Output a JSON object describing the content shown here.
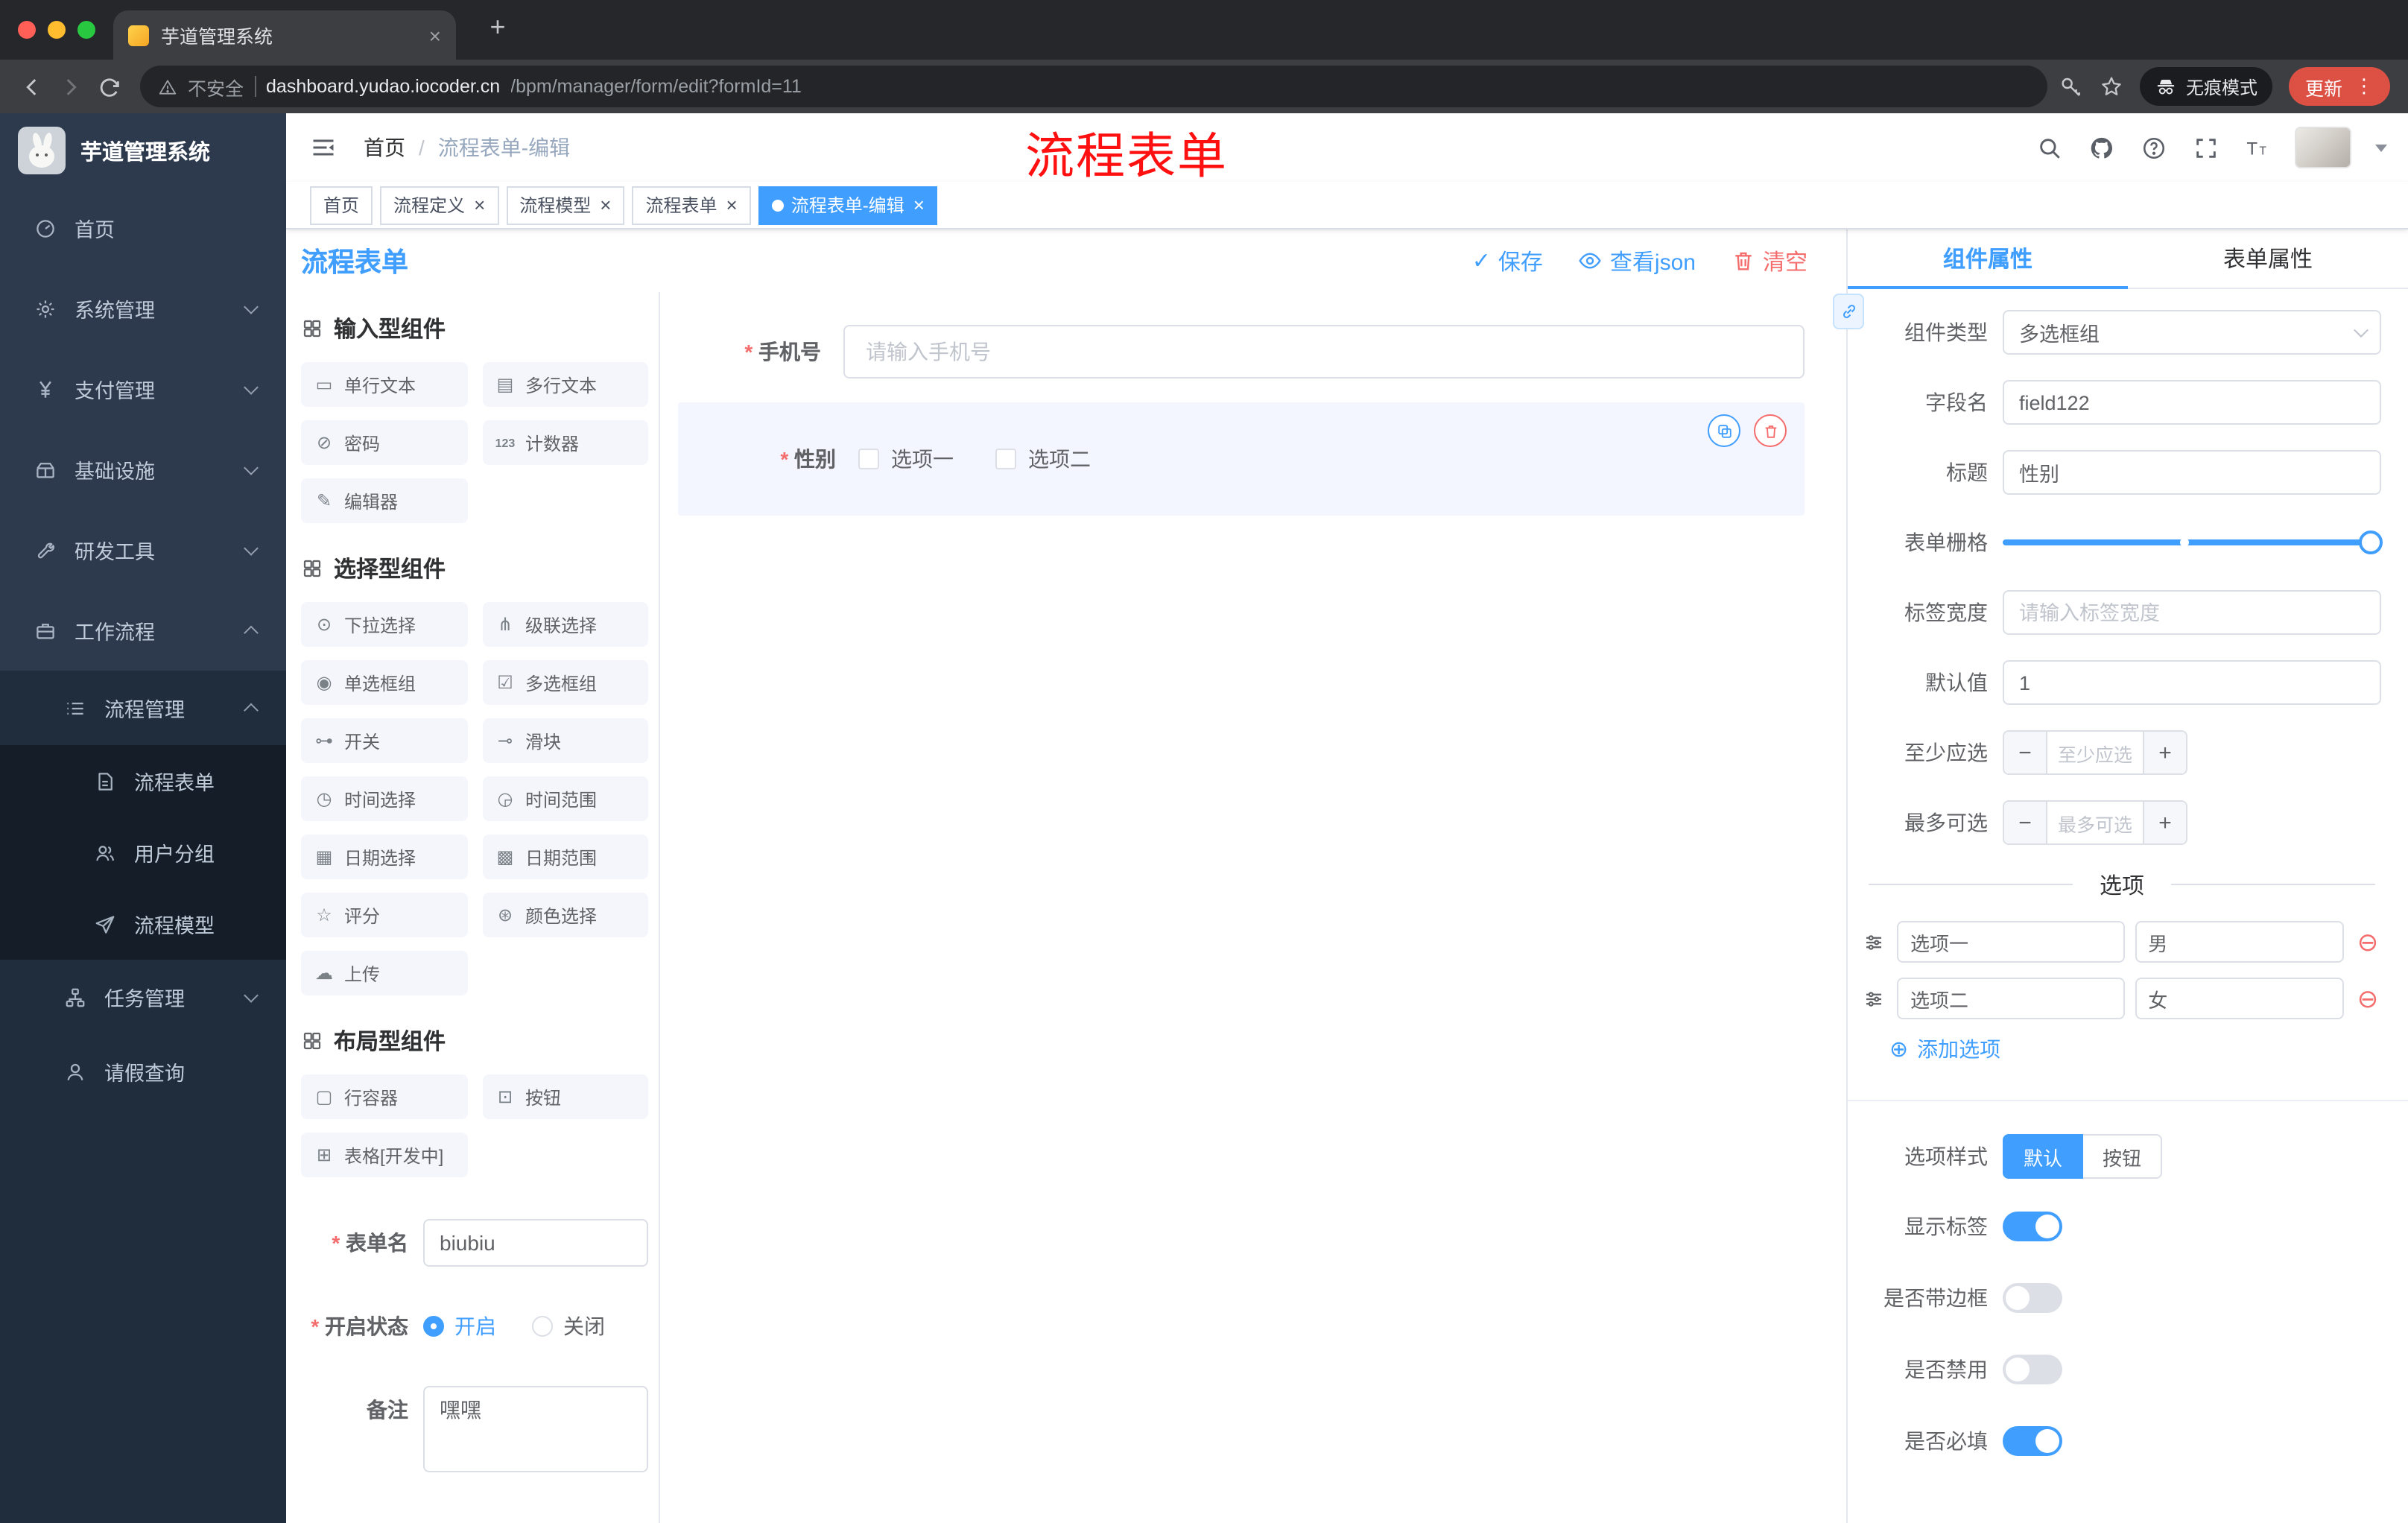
{
  "colors": {
    "accent": "#409eff",
    "danger": "#f56c6c",
    "annotation_red": "#fe1010",
    "update_badge": "#dd5144",
    "sidebar_bg": "#2d3a4d"
  },
  "browser": {
    "tab": {
      "title": "芋道管理系统"
    },
    "address": {
      "security": "不安全",
      "host": "dashboard.yudao.iocoder.cn",
      "path": "/bpm/manager/form/edit?formId=11"
    },
    "incognito_label": "无痕模式",
    "update_label": "更新"
  },
  "sidebar": {
    "logo_title": "芋道管理系统",
    "menu": [
      {
        "label": "首页",
        "icon": "dashboard-icon",
        "level": 1
      },
      {
        "label": "系统管理",
        "icon": "gear-icon",
        "level": 1,
        "chevron": "down"
      },
      {
        "label": "支付管理",
        "icon": "yen-icon",
        "level": 1,
        "chevron": "down"
      },
      {
        "label": "基础设施",
        "icon": "infra-icon",
        "level": 1,
        "chevron": "down"
      },
      {
        "label": "研发工具",
        "icon": "tools-icon",
        "level": 1,
        "chevron": "down"
      },
      {
        "label": "工作流程",
        "icon": "workflow-icon",
        "level": 1,
        "chevron": "up"
      },
      {
        "label": "流程管理",
        "icon": "list-icon",
        "level": 2,
        "chevron": "up"
      },
      {
        "label": "流程表单",
        "icon": "form-icon",
        "level": 3
      },
      {
        "label": "用户分组",
        "icon": "users-icon",
        "level": 3
      },
      {
        "label": "流程模型",
        "icon": "send-icon",
        "level": 3
      },
      {
        "label": "任务管理",
        "icon": "tasks-icon",
        "level": 2,
        "chevron": "down"
      },
      {
        "label": "请假查询",
        "icon": "person-icon",
        "level": 2
      }
    ]
  },
  "header": {
    "breadcrumb": [
      "首页",
      "流程表单-编辑"
    ],
    "annotation": "流程表单"
  },
  "tags": [
    {
      "label": "首页",
      "closable": false,
      "active": false
    },
    {
      "label": "流程定义",
      "closable": true,
      "active": false
    },
    {
      "label": "流程模型",
      "closable": true,
      "active": false
    },
    {
      "label": "流程表单",
      "closable": true,
      "active": false
    },
    {
      "label": "流程表单-编辑",
      "closable": true,
      "active": true
    }
  ],
  "designer": {
    "title": "流程表单",
    "actions": {
      "save": "保存",
      "view_json": "查看json",
      "clear": "清空"
    },
    "palette": {
      "sections": [
        {
          "title": "输入型组件",
          "items": [
            {
              "label": "单行文本",
              "icon": "input-icon"
            },
            {
              "label": "多行文本",
              "icon": "textarea-icon"
            },
            {
              "label": "密码",
              "icon": "password-icon"
            },
            {
              "label": "计数器",
              "icon": "counter-icon"
            },
            {
              "label": "编辑器",
              "icon": "editor-icon"
            }
          ]
        },
        {
          "title": "选择型组件",
          "items": [
            {
              "label": "下拉选择",
              "icon": "select-icon"
            },
            {
              "label": "级联选择",
              "icon": "cascader-icon"
            },
            {
              "label": "单选框组",
              "icon": "radio-icon"
            },
            {
              "label": "多选框组",
              "icon": "checkbox-icon"
            },
            {
              "label": "开关",
              "icon": "switch-icon"
            },
            {
              "label": "滑块",
              "icon": "slider-icon"
            },
            {
              "label": "时间选择",
              "icon": "time-icon"
            },
            {
              "label": "时间范围",
              "icon": "time-range-icon"
            },
            {
              "label": "日期选择",
              "icon": "date-icon"
            },
            {
              "label": "日期范围",
              "icon": "date-range-icon"
            },
            {
              "label": "评分",
              "icon": "rate-icon"
            },
            {
              "label": "颜色选择",
              "icon": "color-icon"
            },
            {
              "label": "上传",
              "icon": "upload-icon"
            }
          ]
        },
        {
          "title": "布局型组件",
          "items": [
            {
              "label": "行容器",
              "icon": "row-icon"
            },
            {
              "label": "按钮",
              "icon": "button-icon"
            },
            {
              "label": "表格[开发中]",
              "icon": "table-icon"
            }
          ]
        }
      ]
    },
    "meta_form": {
      "form_name_label": "表单名",
      "form_name_value": "biubiu",
      "status_label": "开启状态",
      "status_options": [
        "开启",
        "关闭"
      ],
      "status_selected": "开启",
      "remark_label": "备注",
      "remark_value": "嘿嘿"
    },
    "canvas": {
      "phone_field": {
        "required": true,
        "label": "手机号",
        "placeholder": "请输入手机号"
      },
      "gender_field": {
        "required": true,
        "label": "性别",
        "options": [
          "选项一",
          "选项二"
        ],
        "selected": true
      }
    },
    "properties": {
      "tabs": [
        "组件属性",
        "表单属性"
      ],
      "active_tab": "组件属性",
      "fields": {
        "component_type_label": "组件类型",
        "component_type_value": "多选框组",
        "field_name_label": "字段名",
        "field_name_value": "field122",
        "title_label": "标题",
        "title_value": "性别",
        "grid_label": "表单栅格",
        "label_width_label": "标签宽度",
        "label_width_placeholder": "请输入标签宽度",
        "default_label": "默认值",
        "default_value": "1",
        "min_label": "至少应选",
        "min_placeholder": "至少应选",
        "max_label": "最多可选",
        "max_placeholder": "最多可选",
        "options_divider": "选项",
        "options": [
          {
            "label": "选项一",
            "value": "男"
          },
          {
            "label": "选项二",
            "value": "女"
          }
        ],
        "add_option": "添加选项",
        "option_style_label": "选项样式",
        "option_style_options": [
          "默认",
          "按钮"
        ],
        "option_style_selected": "默认",
        "toggles": [
          {
            "label": "显示标签",
            "on": true
          },
          {
            "label": "是否带边框",
            "on": false
          },
          {
            "label": "是否禁用",
            "on": false
          },
          {
            "label": "是否必填",
            "on": true
          }
        ]
      }
    }
  }
}
